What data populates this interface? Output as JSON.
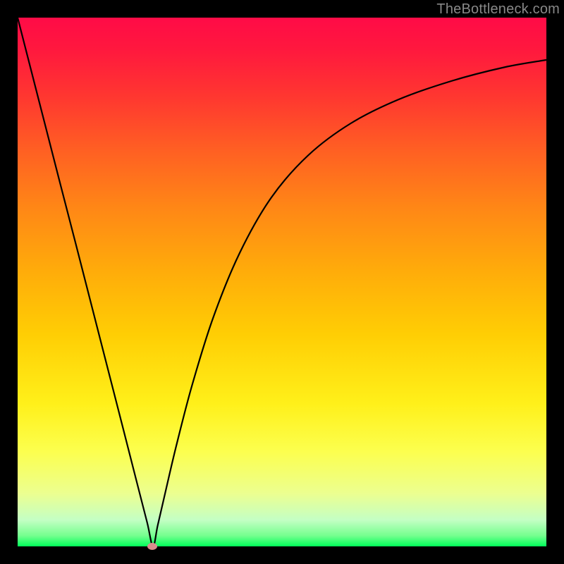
{
  "watermark": "TheBottleneck.com",
  "chart_data": {
    "type": "line",
    "title": "",
    "xlabel": "",
    "ylabel": "",
    "xlim": [
      0,
      1
    ],
    "ylim": [
      0,
      1
    ],
    "grid": false,
    "legend": false,
    "annotations": [
      {
        "kind": "marker",
        "shape": "ellipse",
        "x": 0.255,
        "y": 0.0,
        "color": "#d98d8d"
      }
    ],
    "series": [
      {
        "name": "curve",
        "color": "#000000",
        "x": [
          0.0,
          0.02,
          0.05,
          0.08,
          0.11,
          0.14,
          0.17,
          0.2,
          0.225,
          0.245,
          0.256,
          0.265,
          0.28,
          0.3,
          0.33,
          0.37,
          0.42,
          0.48,
          0.55,
          0.63,
          0.72,
          0.82,
          0.92,
          1.0
        ],
        "y": [
          1.0,
          0.922,
          0.805,
          0.688,
          0.572,
          0.455,
          0.338,
          0.221,
          0.123,
          0.045,
          0.0,
          0.04,
          0.105,
          0.19,
          0.305,
          0.433,
          0.555,
          0.66,
          0.74,
          0.8,
          0.845,
          0.88,
          0.906,
          0.92
        ]
      }
    ]
  },
  "colors": {
    "background": "#000000",
    "gradient_top": "#ff0b47",
    "gradient_bottom": "#00ff5a",
    "curve": "#000000",
    "marker": "#d98d8d",
    "watermark": "#888888"
  }
}
